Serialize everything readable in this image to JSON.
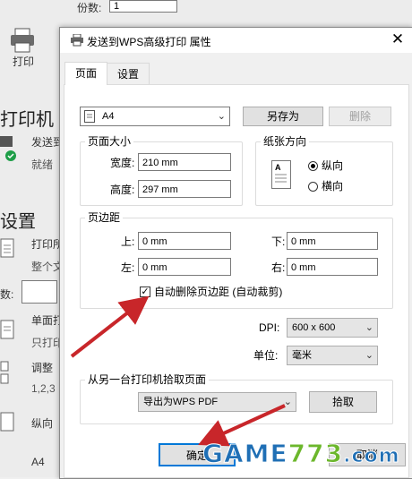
{
  "background": {
    "copies_label": "份数:",
    "copies_value": "1",
    "print_label": "打印",
    "printer_heading": "打印机",
    "printer_name": "发送到",
    "printer_status": "就绪",
    "settings_heading": "设置",
    "row1_a": "打印所",
    "row1_b": "整个文",
    "pages_label": "数:",
    "row2_a": "单面打",
    "row2_b": "只打印",
    "row3_a": "调整",
    "row3_b": "1,2,3",
    "row4_a": "纵向",
    "row5_a": "A4"
  },
  "dialog": {
    "title": "发送到WPS高级打印 属性",
    "tabs": [
      {
        "label": "页面"
      },
      {
        "label": "设置"
      }
    ],
    "paper_select": "A4",
    "save_as_label": "另存为",
    "delete_label": "删除",
    "page_size_group": "页面大小",
    "width_label": "宽度:",
    "width_value": "210 mm",
    "height_label": "高度:",
    "height_value": "297 mm",
    "orientation_group": "纸张方向",
    "portrait_label": "纵向",
    "landscape_label": "横向",
    "orientation_icon_letter": "A",
    "margins_group": "页边距",
    "top_label": "上:",
    "top_value": "0 mm",
    "bottom_label": "下:",
    "bottom_value": "0 mm",
    "left_label": "左:",
    "left_value": "0 mm",
    "right_label": "右:",
    "right_value": "0 mm",
    "auto_delete_label": "自动删除页边距 (自动裁剪)",
    "auto_delete_checked": true,
    "dpi_label": "DPI:",
    "dpi_value": "600 x 600",
    "unit_label": "单位:",
    "unit_value": "毫米",
    "fetch_group": "从另一台打印机拾取页面",
    "fetch_select": "导出为WPS PDF",
    "pick_label": "拾取",
    "ok_label": "确定",
    "cancel_label": "取消"
  },
  "watermark": {
    "game": "GAME",
    "num": "773",
    "com": ".com"
  },
  "colors": {
    "arrow": "#c8262a",
    "status_ok": "#1e9e48",
    "watermark_blue": "#1f6fb5",
    "watermark_green": "#6cb72c"
  }
}
